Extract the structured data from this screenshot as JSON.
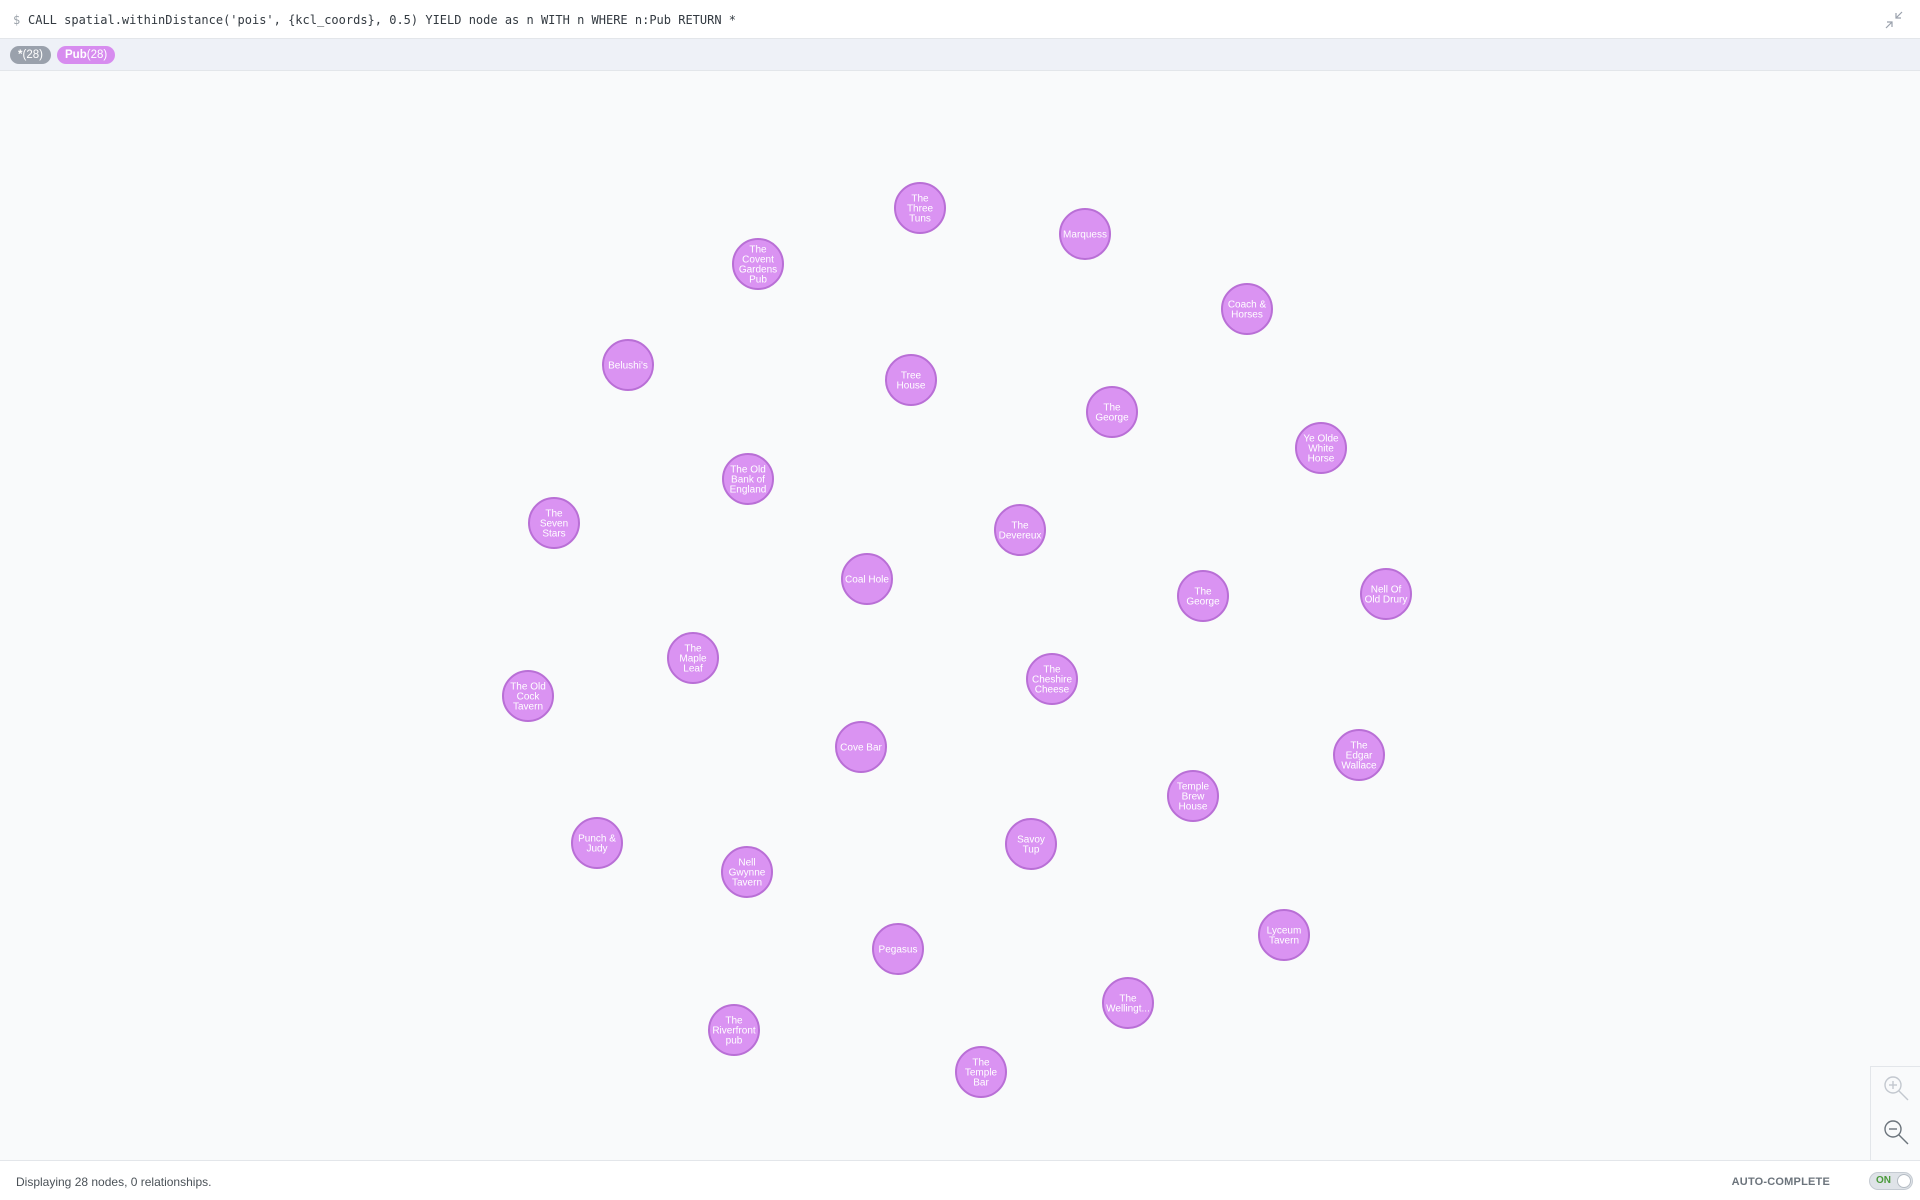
{
  "query": {
    "prompt": "$",
    "text": "CALL spatial.withinDistance('pois', {kcl_coords}, 0.5) YIELD node as n WITH n WHERE n:Pub RETURN *",
    "collapse_icon": "collapse-arrows-icon"
  },
  "labels": {
    "all": {
      "name": "*",
      "count": "(28)"
    },
    "pub": {
      "name": "Pub",
      "count": "(28)"
    }
  },
  "graph": {
    "node_color": "#da93f2",
    "node_border": "#b96fd6",
    "nodes": [
      {
        "label": "The Three Tuns"
      },
      {
        "label": "Marquess"
      },
      {
        "label": "The Covent Gardens Pub"
      },
      {
        "label": "Coach & Horses"
      },
      {
        "label": "Belushi's"
      },
      {
        "label": "Tree House"
      },
      {
        "label": "The George"
      },
      {
        "label": "Ye Olde White Horse"
      },
      {
        "label": "The Old Bank of England"
      },
      {
        "label": "The Seven Stars"
      },
      {
        "label": "The Devereux"
      },
      {
        "label": "Coal Hole"
      },
      {
        "label": "The George"
      },
      {
        "label": "Nell Of Old Drury"
      },
      {
        "label": "The Maple Leaf"
      },
      {
        "label": "The Cheshire Cheese"
      },
      {
        "label": "The Old Cock Tavern"
      },
      {
        "label": "Cove Bar"
      },
      {
        "label": "The Edgar Wallace"
      },
      {
        "label": "Temple Brew House"
      },
      {
        "label": "Punch & Judy"
      },
      {
        "label": "Savoy Tup"
      },
      {
        "label": "Nell Gwynne Tavern"
      },
      {
        "label": "Pegasus"
      },
      {
        "label": "Lyceum Tavern"
      },
      {
        "label": "The Wellingt..."
      },
      {
        "label": "The Riverfront pub"
      },
      {
        "label": "The Temple Bar"
      }
    ]
  },
  "zoom": {
    "zoom_in_icon": "zoom-in-icon",
    "zoom_out_icon": "zoom-out-icon"
  },
  "footer": {
    "status": "Displaying 28 nodes, 0 relationships.",
    "autocomplete_label": "AUTO-COMPLETE",
    "toggle_state": "ON"
  }
}
